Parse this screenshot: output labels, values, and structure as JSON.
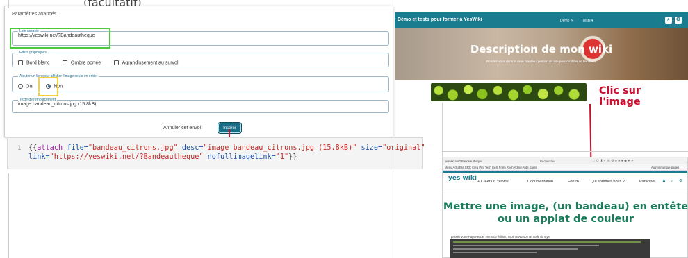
{
  "top_cut_text": "(facultatif)",
  "form": {
    "title": "Paramètres avancés",
    "link_legend": "Lien associé",
    "link_value": "https://yeswiki.net/?Bandeautheque",
    "effects_legend": "Effets graphiques",
    "effects": [
      "Bord blanc",
      "Ombre portée",
      "Agrandissement au survol"
    ],
    "link_only_legend": "Ajouter un lien pour afficher l'image seule en entier",
    "link_only_options": [
      "Oui",
      "Non"
    ],
    "link_only_selected": "Non",
    "alt_legend": "Texte de remplacement",
    "alt_value": "image bandeau_citrons.jpg (15.8kB)",
    "cancel_label": "Annuler cet envoi",
    "insert_label": "Insérer"
  },
  "code": {
    "line_number": "1",
    "open": "{{",
    "action": "attach",
    "file_attr": "file=",
    "file_val": "\"bandeau_citrons.jpg\"",
    "desc_attr": "desc=",
    "desc_val": "\"image bandeau_citrons.jpg (15.8kB)\"",
    "size_attr": "size=",
    "size_val": "\"original\"",
    "link_attr": "link=",
    "link_val": "\"https://yeswiki.net/?Bandeautheque\"",
    "nofull_attr": "nofullimagelink=",
    "nofull_val": "\"1\"",
    "close": "}}"
  },
  "shot_top": {
    "site_title": "Démo et tests pour former à YesWiki",
    "nav_items": [
      "Demo ✎",
      "Tests ▾"
    ],
    "hero_title": "Description de mon wiki",
    "hero_sub": "Rendez-vous dans la roue crantée / gestion du site pour modifier ce bandeau."
  },
  "annotation": {
    "text_line1": "Clic sur",
    "text_line2": "l'image",
    "color": "#c8102e"
  },
  "shot_bottom": {
    "url": "yeswiki.net/?Bandeautheque",
    "search": "Rechercher",
    "bookmarks": "Menu  Actu  Ess  ERC  Crea  Proj  Tech  Gest  Form  Rech  Admin  Aide  Santé",
    "bookmarks_right": "Autres marque-pages",
    "logo": "yes wiki",
    "nav": [
      "+ Créer un Yeswiki",
      "Documentation",
      "Forum",
      "Qui sommes nous ?",
      "Participer"
    ],
    "title_line1": "Mettre une image, (un bandeau) en entête",
    "title_line2": "ou un applat de couleur",
    "body_text": "passez votre PageHeader en mode édition, nous devez voir un code du style"
  },
  "colors": {
    "accent": "#1a7c8f",
    "highlight_green": "#4cc93a",
    "highlight_yellow": "#f2d23a",
    "title_green": "#1a7c5c"
  }
}
